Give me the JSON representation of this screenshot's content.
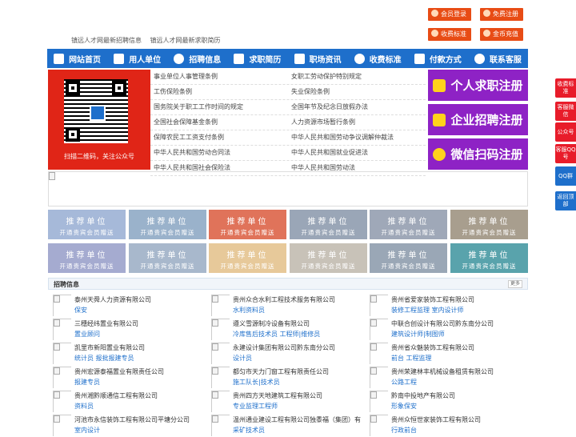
{
  "top_links": [
    "镇远人才网最新招聘信息",
    "镇远人才网最新求职简历"
  ],
  "top_buttons": [
    {
      "label": "会员登录",
      "icon": "user-icon"
    },
    {
      "label": "免费注册",
      "icon": "user-add-icon"
    },
    {
      "label": "收费标准",
      "icon": "yen-icon"
    },
    {
      "label": "金币充值",
      "icon": "coin-icon"
    }
  ],
  "nav": [
    {
      "label": "网站首页",
      "icon": "home-icon"
    },
    {
      "label": "用人单位",
      "icon": "building-icon"
    },
    {
      "label": "招聘信息",
      "icon": "chat-icon"
    },
    {
      "label": "求职简历",
      "icon": "resume-icon"
    },
    {
      "label": "职场资讯",
      "icon": "news-icon"
    },
    {
      "label": "收费标准",
      "icon": "yen-icon"
    },
    {
      "label": "付款方式",
      "icon": "payment-icon"
    },
    {
      "label": "联系客服",
      "icon": "phone-icon"
    }
  ],
  "qr_caption": "扫描二维码，关注公众号",
  "rules": [
    [
      "事业单位人事管理条例",
      "女职工劳动保护特别规定"
    ],
    [
      "工伤保险条例",
      "失业保险条例"
    ],
    [
      "国务院关于职工工作时间的规定",
      "全国年节及纪念日放假办法"
    ],
    [
      "全国社会保障基金条例",
      "人力资源市场暂行条例"
    ],
    [
      "保障农民工工资支付条例",
      "中华人民共和国劳动争议调解仲裁法"
    ],
    [
      "中华人民共和国劳动合同法",
      "中华人民共和国就业促进法"
    ],
    [
      "中华人民共和国社会保险法",
      "中华人民共和国劳动法"
    ]
  ],
  "register_buttons": [
    "个人求职注册",
    "企业招聘注册",
    "微信扫码注册"
  ],
  "tiles": {
    "title": "推荐单位",
    "subtitle": "开通贵宾会员赠送",
    "colors": [
      "#a6b9d9",
      "#9ab2cb",
      "#e0735a",
      "#9aa6b7",
      "#9fa8b8",
      "#a89e8e",
      "#a5abd0",
      "#a8b8cc",
      "#e7c99a",
      "#c8c2b8",
      "#b88a2a",
      "#9aa7b6",
      "#59a3ac"
    ]
  },
  "jobs": {
    "title": "招聘信息",
    "more": "更多",
    "items": [
      {
        "company": "泰州天舜人力资源有限公司",
        "position": "保安"
      },
      {
        "company": "贵州众合水利工程技术服务有限公司",
        "position": "水利资料员"
      },
      {
        "company": "贵州省爱家装饰工程有限公司",
        "position": "装修工程监理 室内设计师"
      },
      {
        "company": "三穗经纬置业有限公司",
        "position": "置业顾问"
      },
      {
        "company": "遵义雪源制冷设备有限公司",
        "position": "冷库售后技术员 工程师|维修员"
      },
      {
        "company": "中联合创设计有限公司黔东南分公司",
        "position": "建筑设计师|制图师"
      },
      {
        "company": "凯里市新阳置业有限公司",
        "position": "统计员 报批报建专员"
      },
      {
        "company": "永建设计集团有限公司黔东南分公司",
        "position": "设计员"
      },
      {
        "company": "贵州省众魅装饰工程有限公司",
        "position": "前台 工程监理"
      },
      {
        "company": "贵州宏源泰福置业有限责任公司",
        "position": "报建专员"
      },
      {
        "company": "都匀市天力门窗工程有限责任公司",
        "position": "施工队长|技术员"
      },
      {
        "company": "贵州荣建林丰机械设备租赁有限公司",
        "position": "公路工程"
      },
      {
        "company": "贵州湘黔顺通信工程有限公司",
        "position": "资料员"
      },
      {
        "company": "贵州四方天地建筑工程有限公司",
        "position": "专业监理工程师"
      },
      {
        "company": "黔南中投地产有限公司",
        "position": "形象保安"
      },
      {
        "company": "河池市永信装饰工程有限公司平塘分公司",
        "position": "室内设计"
      },
      {
        "company": "温州通业建设工程有限公司独黍福（集团）有",
        "position": "采矿技术员"
      },
      {
        "company": "贵州众恒世家装饰工程有限公司",
        "position": "行政前台"
      }
    ]
  },
  "float_bar": [
    "收费标准",
    "客服微信",
    "公众号",
    "客服QQ号",
    "QQ群",
    "返回顶部"
  ]
}
